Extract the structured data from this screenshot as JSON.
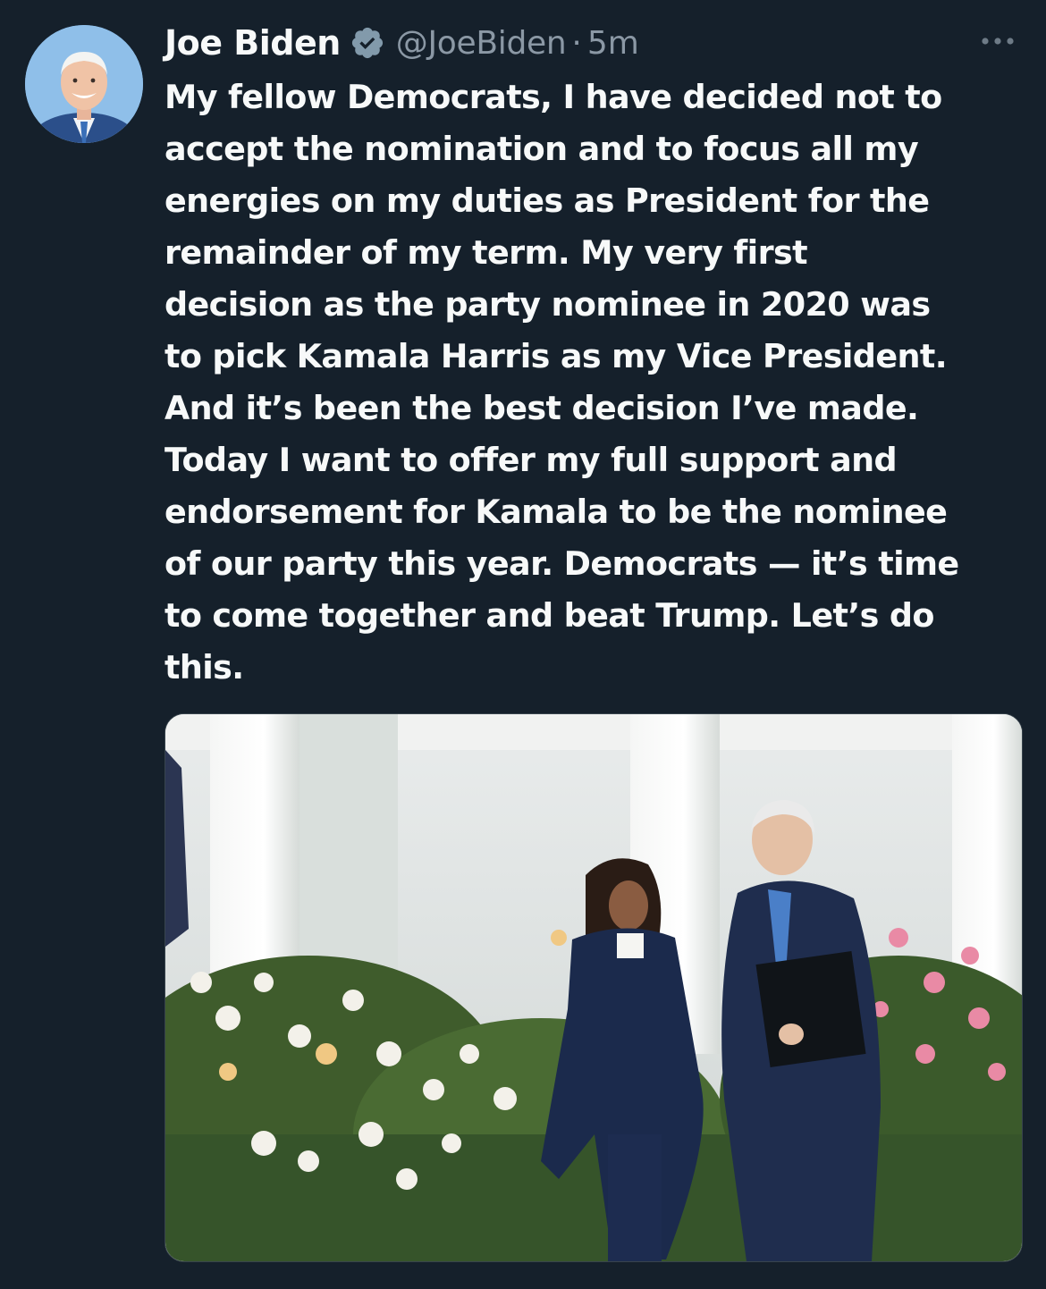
{
  "tweet": {
    "author": {
      "name": "Joe Biden",
      "handle": "@JoeBiden",
      "verified": true,
      "avatar_icon": "profile-photo"
    },
    "separator": "·",
    "timestamp": "5m",
    "more_icon": "ellipsis-icon",
    "text": "My fellow Democrats, I have decided not to\naccept the nomination and to focus all my\nenergies on my duties as President for the\nremainder of my term. My very first\ndecision as the party nominee in 2020 was\nto pick Kamala Harris as my Vice President.\nAnd it’s been the best decision I’ve made.\nToday I want to offer my full support and\nendorsement for Kamala to be the nominee\nof our party this year. Democrats — it’s time\nto come together and beat Trump. Let’s do\nthis.",
    "media": {
      "type": "photo"
    }
  },
  "colors": {
    "background": "#15202b",
    "text_primary": "#f7f9f9",
    "text_secondary": "#8b98a5",
    "verified_badge": "#829aab"
  }
}
